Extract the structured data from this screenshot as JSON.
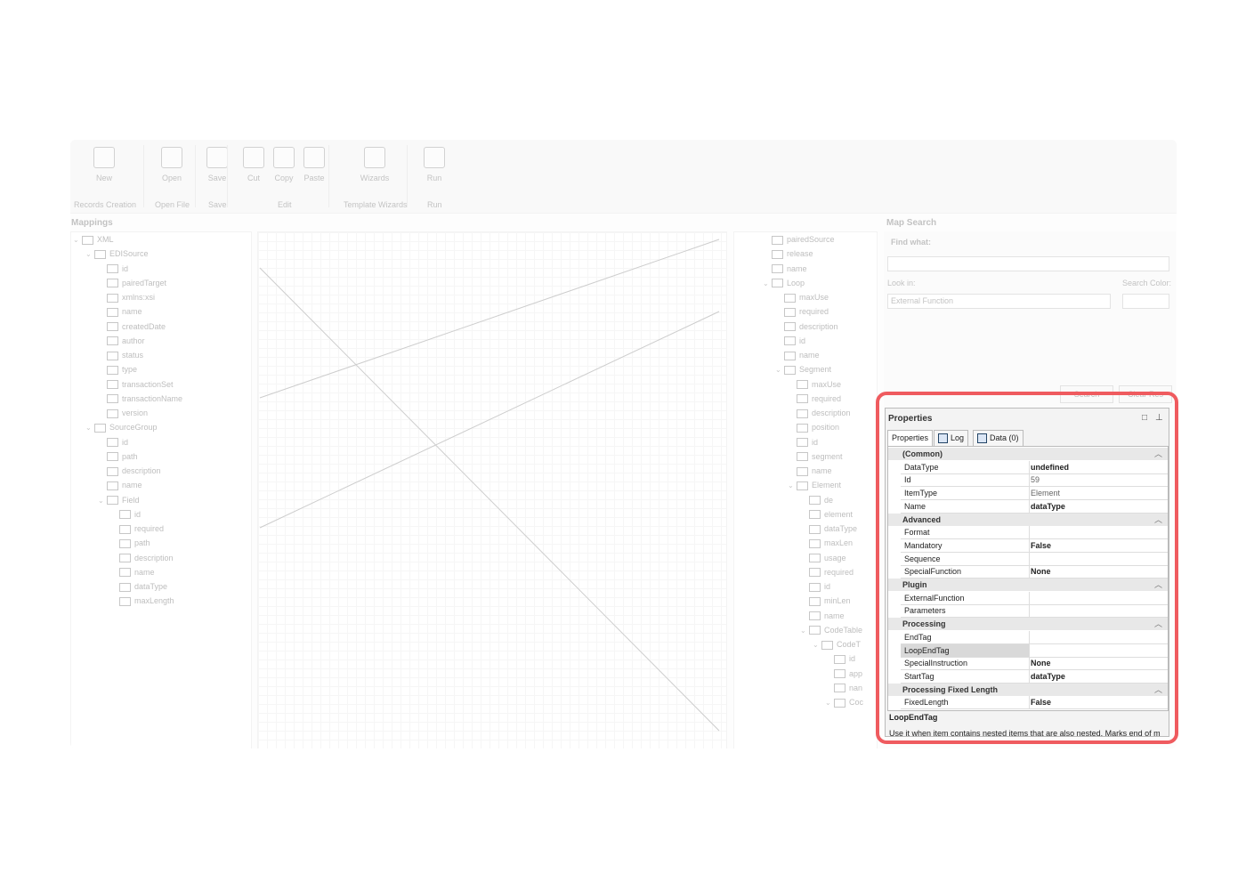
{
  "ribbon": {
    "buttons": [
      {
        "label": "New",
        "icon": "new-record-icon"
      },
      {
        "label": "Open",
        "icon": "open-icon"
      },
      {
        "label": "Save",
        "icon": "save-icon"
      },
      {
        "label": "Cut",
        "icon": "cut-icon"
      },
      {
        "label": "Copy",
        "icon": "copy-icon"
      },
      {
        "label": "Paste",
        "icon": "paste-icon"
      },
      {
        "label": "Wizards",
        "icon": "wizard-icon"
      },
      {
        "label": "Run",
        "icon": "run-icon"
      }
    ],
    "groups": [
      "Records Creation",
      "Open File",
      "Save",
      "Edit",
      "Template Wizards",
      "Run"
    ]
  },
  "mappings": {
    "title": "Mappings",
    "source_tree": [
      "XML",
      "EDISource",
      "id",
      "pairedTarget",
      "xmlns:xsi",
      "name",
      "createdDate",
      "author",
      "status",
      "type",
      "transactionSet",
      "transactionName",
      "version",
      "SourceGroup",
      "id",
      "path",
      "description",
      "name",
      "Field",
      "id",
      "required",
      "path",
      "description",
      "name",
      "dataType",
      "maxLength"
    ],
    "target_tree": [
      "pairedSource",
      "release",
      "name",
      "Loop",
      "maxUse",
      "required",
      "description",
      "id",
      "name",
      "Segment",
      "maxUse",
      "required",
      "description",
      "position",
      "id",
      "segment",
      "name",
      "Element",
      "de",
      "element",
      "dataType",
      "maxLen",
      "usage",
      "required",
      "id",
      "minLen",
      "name",
      "CodeTable",
      "CodeT",
      "id",
      "app",
      "nan",
      "Coc"
    ]
  },
  "map_search": {
    "title": "Map Search",
    "find_what": "Find what:",
    "look_in": "Look in:",
    "look_in_value": "External Function",
    "search_color": "Search Color:",
    "search_button": "Search",
    "clear_button": "Clear Res"
  },
  "properties": {
    "title": "Properties",
    "tabs": [
      {
        "label": "Properties",
        "icon": ""
      },
      {
        "label": "Log",
        "icon": "log-icon"
      },
      {
        "label": "Data (0)",
        "icon": "data-icon"
      }
    ],
    "categories": [
      {
        "name": "(Common)",
        "rows": [
          {
            "key": "DataType",
            "value": "undefined",
            "style": "b"
          },
          {
            "key": "Id",
            "value": "59",
            "style": "g"
          },
          {
            "key": "ItemType",
            "value": "Element",
            "style": "g"
          },
          {
            "key": "Name",
            "value": "dataType",
            "style": "b"
          }
        ]
      },
      {
        "name": "Advanced",
        "rows": [
          {
            "key": "Format",
            "value": "",
            "style": ""
          },
          {
            "key": "Mandatory",
            "value": "False",
            "style": "b"
          },
          {
            "key": "Sequence",
            "value": "",
            "style": ""
          },
          {
            "key": "SpecialFunction",
            "value": "None",
            "style": "b"
          }
        ]
      },
      {
        "name": "Plugin",
        "rows": [
          {
            "key": "ExternalFunction",
            "value": "",
            "style": ""
          },
          {
            "key": "Parameters",
            "value": "",
            "style": ""
          }
        ]
      },
      {
        "name": "Processing",
        "rows": [
          {
            "key": "EndTag",
            "value": "",
            "style": ""
          },
          {
            "key": "LoopEndTag",
            "value": "",
            "style": "",
            "selected": true
          },
          {
            "key": "SpecialInstruction",
            "value": "None",
            "style": "b"
          },
          {
            "key": "StartTag",
            "value": "dataType",
            "style": "b"
          }
        ]
      },
      {
        "name": "Processing Fixed Length",
        "rows": [
          {
            "key": "FixedLength",
            "value": "False",
            "style": "b"
          }
        ]
      }
    ],
    "description_title": "LoopEndTag",
    "description_text": "Use it when item contains nested items that are also nested. Marks end of m"
  }
}
